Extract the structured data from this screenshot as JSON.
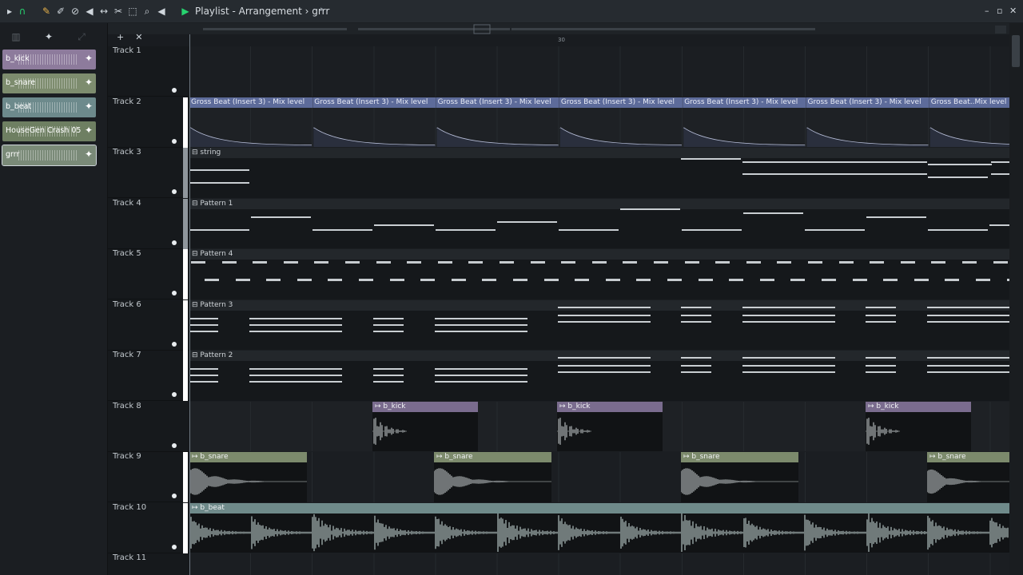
{
  "window": {
    "title_full": "Playlist - Arrangement",
    "crumb_separator": "›",
    "arrangement_name": "grrr",
    "controls": [
      "–",
      "▫",
      "✕"
    ]
  },
  "toolbar": {
    "icons": [
      "play-menu-icon",
      "magnet-icon",
      "pencil-icon",
      "paint-icon",
      "delete-icon",
      "mute-icon",
      "slip-icon",
      "slice-icon",
      "select-icon",
      "zoom-icon",
      "playback-icon"
    ]
  },
  "sidebar": {
    "channels": [
      {
        "label": "b_kick",
        "color": "#8d7b9c"
      },
      {
        "label": "b_snare",
        "color": "#7d8c6e"
      },
      {
        "label": "b_beat",
        "color": "#6d8a8c"
      },
      {
        "label": "HouseGen Crash 05",
        "color": "#6e7f62"
      },
      {
        "label": "grrr",
        "color": "#7a8a78"
      }
    ]
  },
  "ruler": {
    "bar_label": "30"
  },
  "tracks": [
    {
      "name": "Track 1"
    },
    {
      "name": "Track 2"
    },
    {
      "name": "Track 3"
    },
    {
      "name": "Track 4"
    },
    {
      "name": "Track 5"
    },
    {
      "name": "Track 6"
    },
    {
      "name": "Track 7"
    },
    {
      "name": "Track 8"
    },
    {
      "name": "Track 9"
    },
    {
      "name": "Track 10"
    },
    {
      "name": "Track 11"
    }
  ],
  "clips": {
    "automation_title": "Gross Beat (Insert 3) - Mix level",
    "automation_last": "Gross Beat..Mix level",
    "string": "string",
    "pattern1": "Pattern 1",
    "pattern4": "Pattern 4",
    "pattern3": "Pattern 3",
    "pattern2": "Pattern 2",
    "kick": "b_kick",
    "snare": "b_snare",
    "beat": "b_beat"
  },
  "colors": {
    "automation": "#5d6b9a",
    "kick": "#7a6c8e",
    "snare": "#7c8a6c",
    "beat": "#6f8a8a",
    "pattern_header": "#23272b"
  }
}
